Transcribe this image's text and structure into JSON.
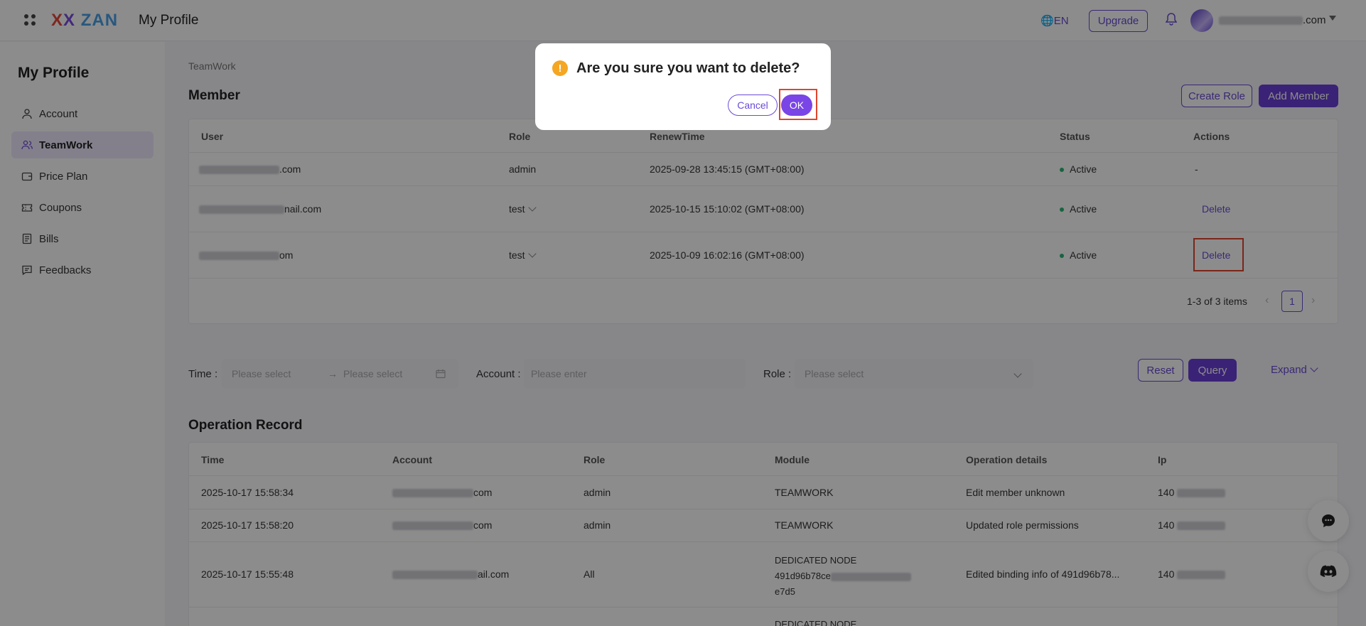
{
  "header": {
    "title": "My Profile",
    "lang": "EN",
    "upgrade": "Upgrade",
    "email_suffix": ".com"
  },
  "sidebar": {
    "title": "My Profile",
    "items": [
      {
        "label": "Account",
        "icon": "user-icon"
      },
      {
        "label": "TeamWork",
        "icon": "team-icon"
      },
      {
        "label": "Price Plan",
        "icon": "wallet-icon"
      },
      {
        "label": "Coupons",
        "icon": "ticket-icon"
      },
      {
        "label": "Bills",
        "icon": "bill-icon"
      },
      {
        "label": "Feedbacks",
        "icon": "feedback-icon"
      }
    ]
  },
  "breadcrumb": "TeamWork",
  "member": {
    "title": "Member",
    "create_role": "Create Role",
    "add_member": "Add Member",
    "columns": [
      "User",
      "Role",
      "RenewTime",
      "Status",
      "Actions"
    ],
    "rows": [
      {
        "user_suffix": ".com",
        "role": "admin",
        "renew": "2025-09-28 13:45:15 (GMT+08:00)",
        "status": "Active",
        "action": "-"
      },
      {
        "user_suffix": "nail.com",
        "role": "test",
        "renew": "2025-10-15 15:10:02 (GMT+08:00)",
        "status": "Active",
        "action": "Delete"
      },
      {
        "user_suffix": "om",
        "role": "test",
        "renew": "2025-10-09 16:02:16 (GMT+08:00)",
        "status": "Active",
        "action": "Delete"
      }
    ],
    "pagination": {
      "summary": "1-3 of 3 items",
      "page": "1"
    }
  },
  "filters": {
    "time_label": "Time",
    "time_start_placeholder": "Please select",
    "time_end_placeholder": "Please select",
    "account_label": "Account",
    "account_placeholder": "Please enter",
    "role_label": "Role",
    "role_placeholder": "Please select",
    "reset": "Reset",
    "query": "Query",
    "expand": "Expand"
  },
  "operation": {
    "title": "Operation Record",
    "columns": [
      "Time",
      "Account",
      "Role",
      "Module",
      "Operation details",
      "Ip"
    ],
    "rows": [
      {
        "time": "2025-10-17 15:58:34",
        "account_suffix": "com",
        "role": "admin",
        "module": "TEAMWORK",
        "details": "Edit member unknown",
        "ip": "140"
      },
      {
        "time": "2025-10-17 15:58:20",
        "account_suffix": "com",
        "role": "admin",
        "module": "TEAMWORK",
        "details": "Updated role permissions",
        "ip": "140"
      },
      {
        "time": "2025-10-17 15:55:48",
        "account_suffix": "ail.com",
        "role": "All",
        "module_l1": "DEDICATED NODE",
        "module_l2": "491d96b78ce",
        "module_l3": "e7d5",
        "details": "Edited binding info of 491d96b78...",
        "ip": "140"
      },
      {
        "module_l1": "DEDICATED NODE"
      }
    ]
  },
  "dialog": {
    "title": "Are you sure you want to delete?",
    "cancel": "Cancel",
    "ok": "OK"
  }
}
